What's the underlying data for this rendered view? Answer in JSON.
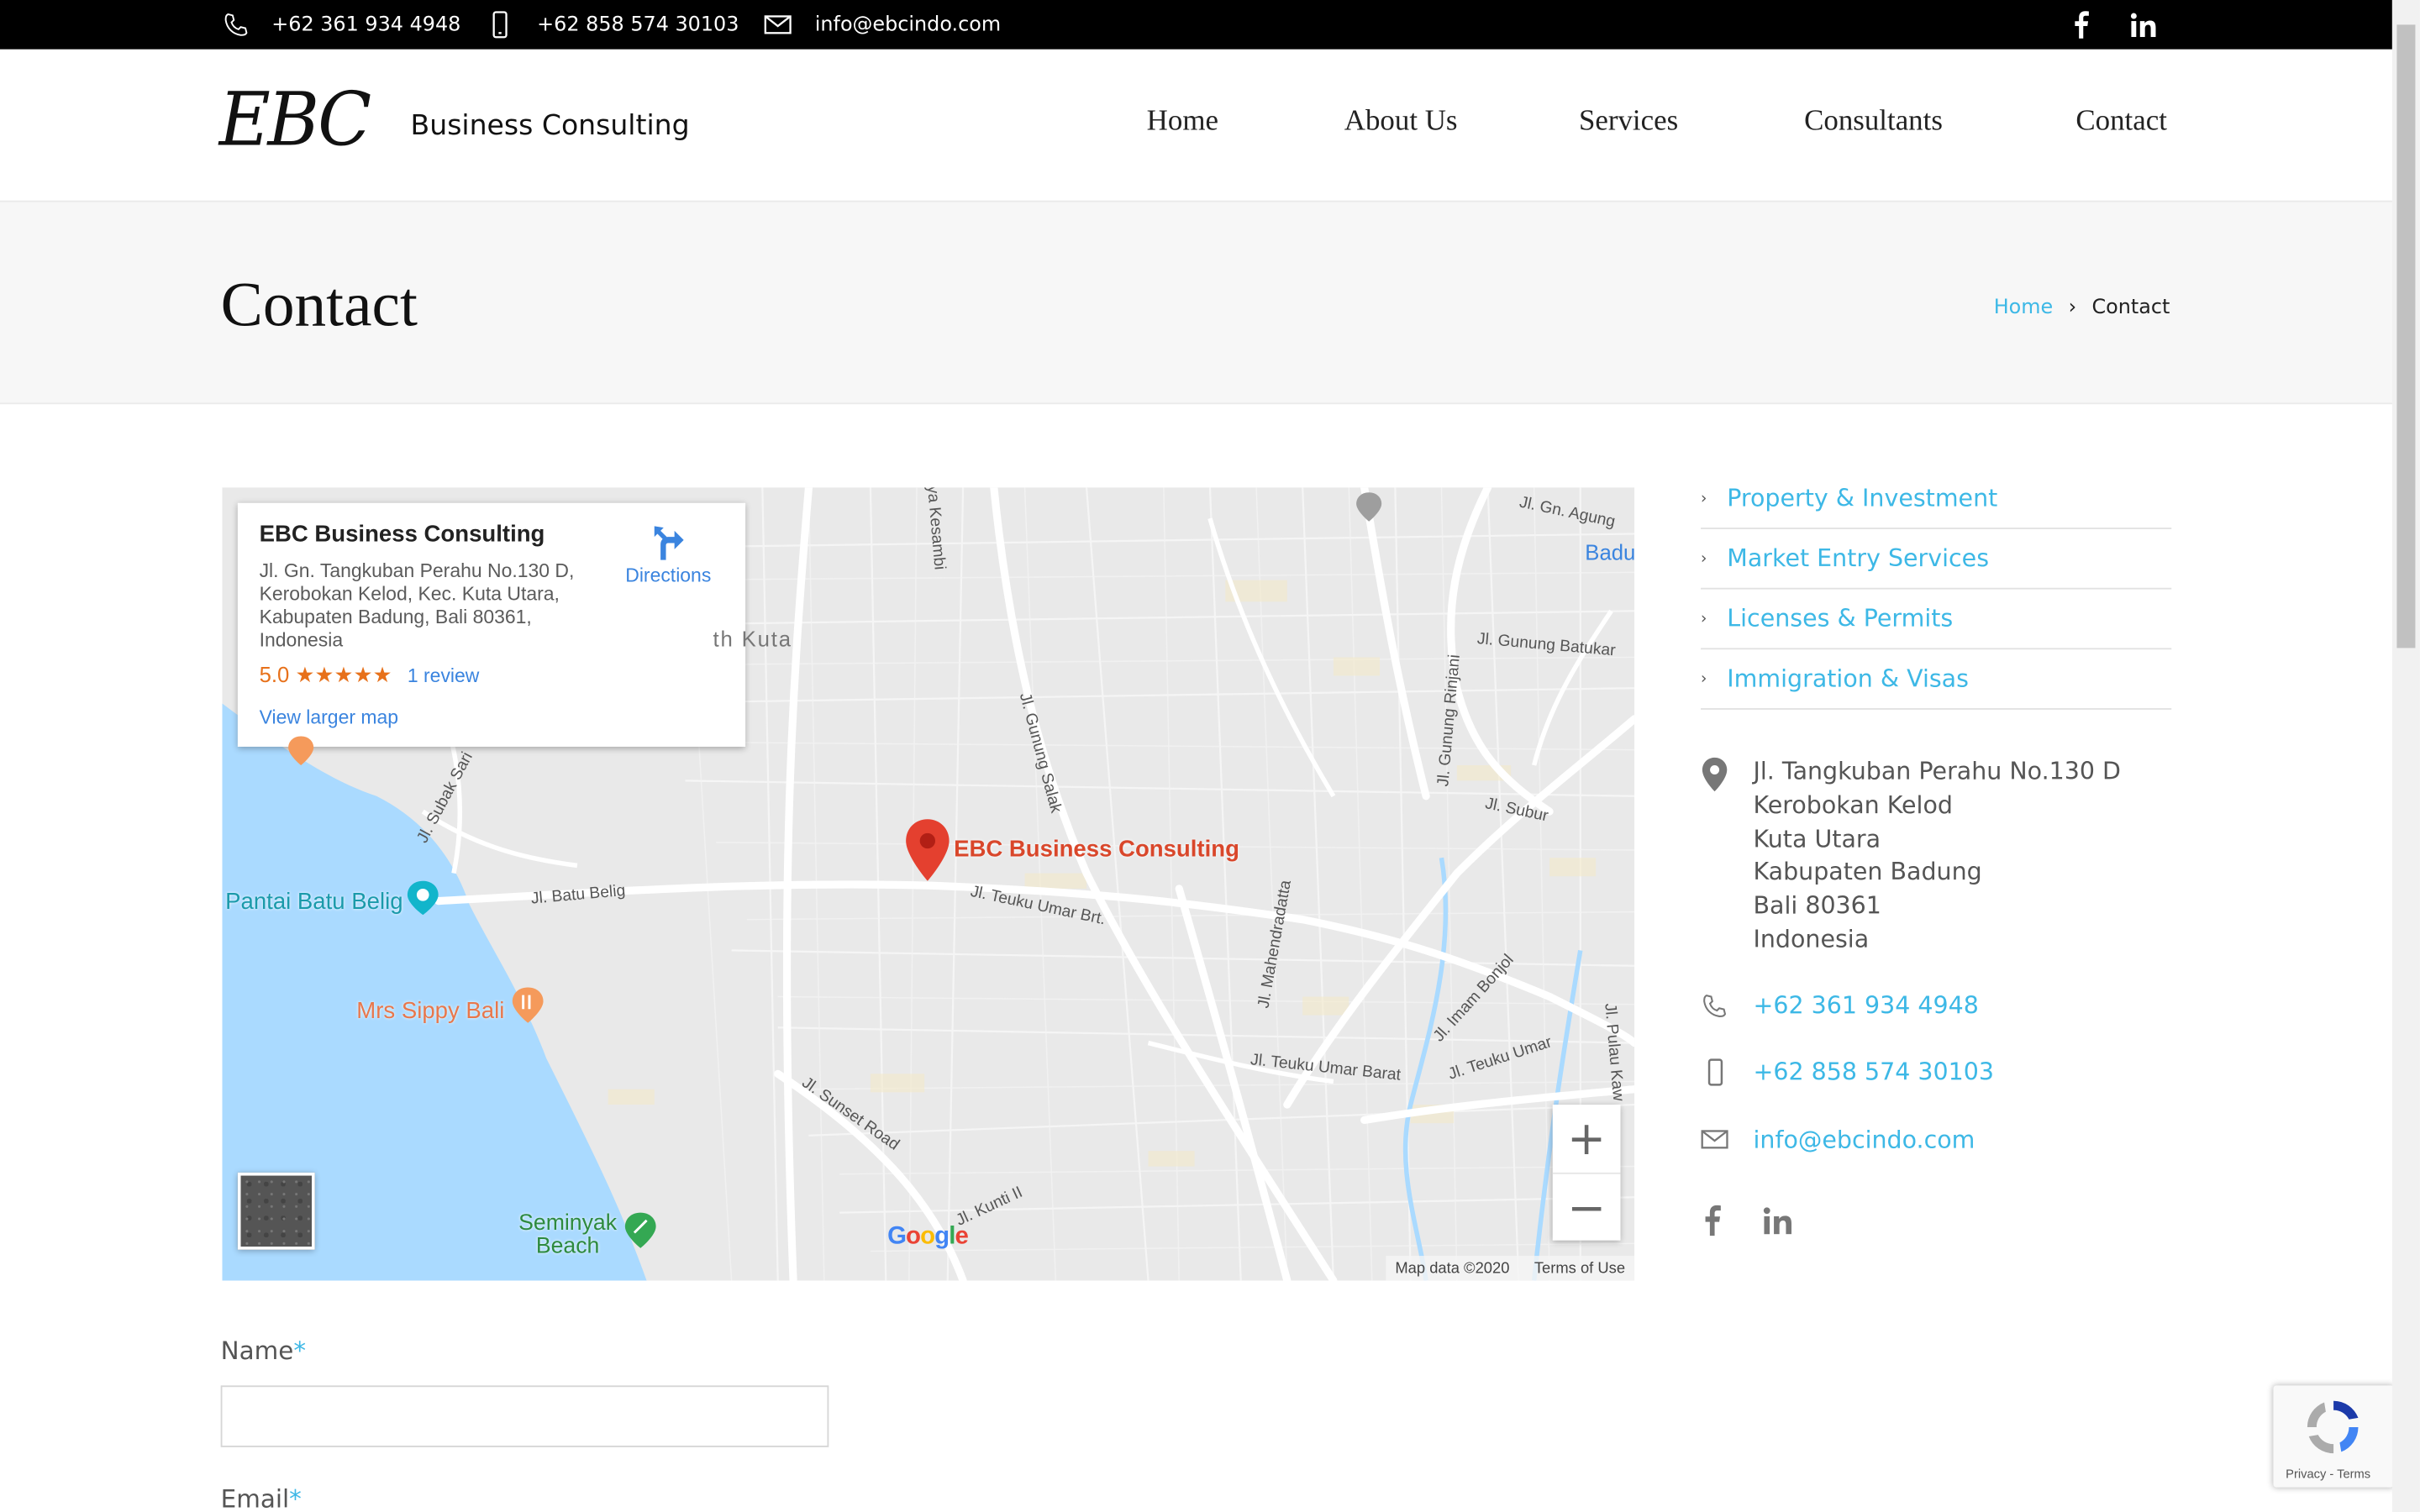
{
  "topbar": {
    "phone": "+62 361 934 4948",
    "mobile": "+62 858 574 30103",
    "email": "info@ebcindo.com",
    "social": [
      "facebook-icon",
      "linkedin-icon"
    ]
  },
  "header": {
    "logo": "EBC",
    "tagline": "Business Consulting",
    "nav": [
      "Home",
      "About Us",
      "Services",
      "Consultants",
      "Contact"
    ]
  },
  "banner": {
    "title": "Contact",
    "breadcrumb_home": "Home",
    "breadcrumb_sep": "›",
    "breadcrumb_current": "Contact"
  },
  "map": {
    "card_name": "EBC Business Consulting",
    "card_address": "Jl. Gn. Tangkuban Perahu No.130 D, Kerobokan Kelod, Kec. Kuta Utara, Kabupaten Badung, Bali 80361, Indonesia",
    "card_rating": "5.0 ★★★★★",
    "card_reviews": "1 review",
    "card_larger": "View larger map",
    "card_directions": "Directions",
    "marker_label": "EBC Business Consulting",
    "labels": {
      "pantai": "Pantai Batu Belig",
      "mrs_sippy": "Mrs Sippy Bali",
      "seminyak": "Seminyak\nBeach",
      "badung": "Badung I",
      "kuta": "th Kuta",
      "batu_belig": "Jl. Batu Belig",
      "teuku_umar_brt": "Jl. Teuku Umar Brt.",
      "teuku_umar_barat": "Jl. Teuku Umar Barat",
      "teuku_umar": "Jl. Teuku Umar",
      "sunset": "Jl. Sunset Road",
      "kunti": "Jl. Kunti II",
      "gunung_salak": "Jl. Gunung Salak",
      "gunung_batukaru": "Jl. Gunung Batukar",
      "gunung_agung": "Jl. Gn. Agung",
      "gunung_rinjani": "Jl. Gunung Rinjani",
      "subur": "Jl. Subur",
      "subak_sari": "Jl. Subak Sari",
      "imam_bonjol": "Jl. Imam Bonjol",
      "mahendradatta": "Jl. Mahendradatta",
      "pulau_kawe": "Jl. Pulau Kaw",
      "kesambi": "ya Kesambi"
    },
    "zoom_in": "+",
    "zoom_out": "−",
    "google": "Google",
    "map_data": "Map data ©2020",
    "terms": "Terms of Use"
  },
  "sidebar": {
    "links": [
      "Property & Investment",
      "Market Entry Services",
      "Licenses & Permits",
      "Immigration & Visas"
    ],
    "address_lines": [
      "Jl. Tangkuban Perahu No.130 D",
      "Kerobokan Kelod",
      "Kuta Utara",
      "Kabupaten Badung",
      "Bali 80361",
      "Indonesia"
    ],
    "phone": "+62 361 934 4948",
    "mobile": "+62 858 574 30103",
    "email": "info@ebcindo.com"
  },
  "form": {
    "name_label": "Name",
    "email_label": "Email",
    "required_mark": "*"
  },
  "recaptcha": {
    "terms": "Privacy - Terms"
  },
  "colors": {
    "accent": "#3db8e6",
    "topbar": "#000000",
    "banner": "#f7f7f7"
  }
}
